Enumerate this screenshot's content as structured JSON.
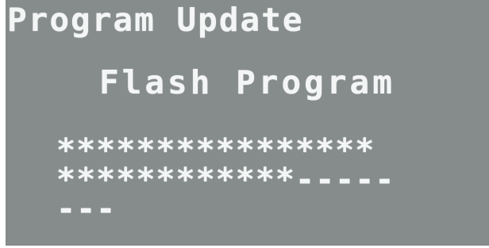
{
  "screen": {
    "title": "Program Update",
    "subtitle": "Flash Program",
    "progress_lines": [
      "****************",
      "************-----",
      "---"
    ]
  },
  "colors": {
    "background": "#868b8c",
    "text": "#f4f6f6"
  }
}
